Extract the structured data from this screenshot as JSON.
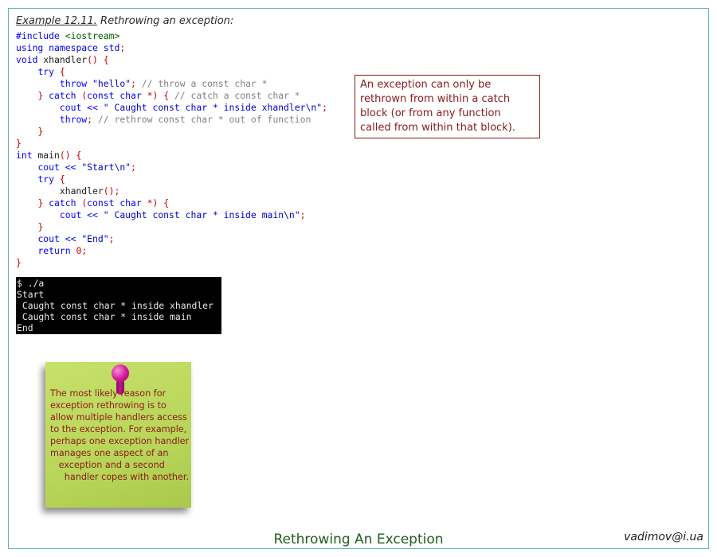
{
  "example": {
    "number": "Example 12.11.",
    "title": "Rethrowing an exception:"
  },
  "code_lines": [
    "#include <iostream>",
    "using namespace std;",
    "void xhandler() {",
    "    try {",
    "        throw \"hello\"; // throw a const char *",
    "    } catch (const char *) { // catch a const char *",
    "        cout << \" Caught const char * inside xhandler\\n\";",
    "        throw; // rethrow const char * out of function",
    "    }",
    "}",
    "int main() {",
    "    cout << \"Start\\n\";",
    "    try {",
    "        xhandler();",
    "    } catch (const char *) {",
    "        cout << \" Caught const char * inside main\\n\";",
    "    }",
    "    cout << \"End\";",
    "    return 0;",
    "}"
  ],
  "terminal_lines": [
    "$ ./a",
    "Start",
    " Caught const char * inside xhandler",
    " Caught const char * inside main",
    "End"
  ],
  "callout": {
    "text": "An exception can only be rethrown from within a catch block (or from any function called from within that block)."
  },
  "sticky_note": {
    "lines": [
      "The most likely reason for",
      "exception rethrowing is to",
      "allow multiple handlers access",
      "to the exception. For example,",
      "perhaps one exception handler",
      "manages one aspect of an",
      "   exception and a second",
      "     handler copes with another."
    ]
  },
  "footer": {
    "title": "Rethrowing An Exception",
    "author": "vadimov@i.ua"
  },
  "colors": {
    "keyword": "#0000ff",
    "brace": "#cc0000",
    "comment": "#808080",
    "preprocessor": "#006400",
    "callout_border": "#8b1a1a",
    "frame_border": "#5fb3b3",
    "sticky": "#b8d65a"
  },
  "icons": {
    "pin": "pushpin-icon"
  }
}
